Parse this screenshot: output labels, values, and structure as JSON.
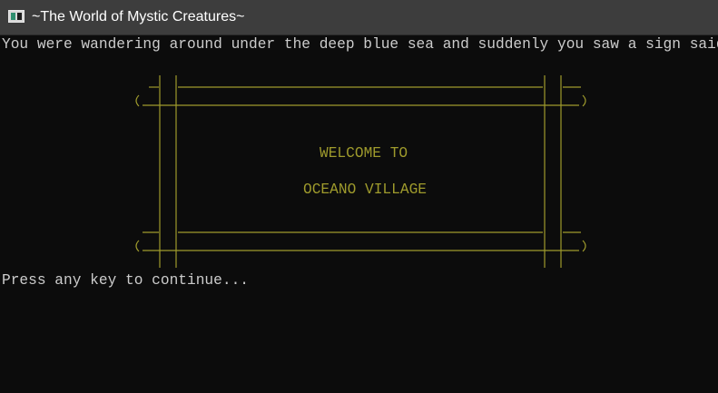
{
  "window": {
    "title": "~The World of Mystic Creatures~",
    "icon": "console-app-icon"
  },
  "console": {
    "intro_text": "You were wandering around under the deep blue sea and suddenly you saw a sign said...",
    "sign": {
      "line1": "WELCOME TO",
      "line2": "OCEANO VILLAGE",
      "color": "#9e9a2c"
    },
    "prompt_text": "Press any key to continue...",
    "text_color": "#cccccc",
    "background": "#0c0c0c"
  }
}
